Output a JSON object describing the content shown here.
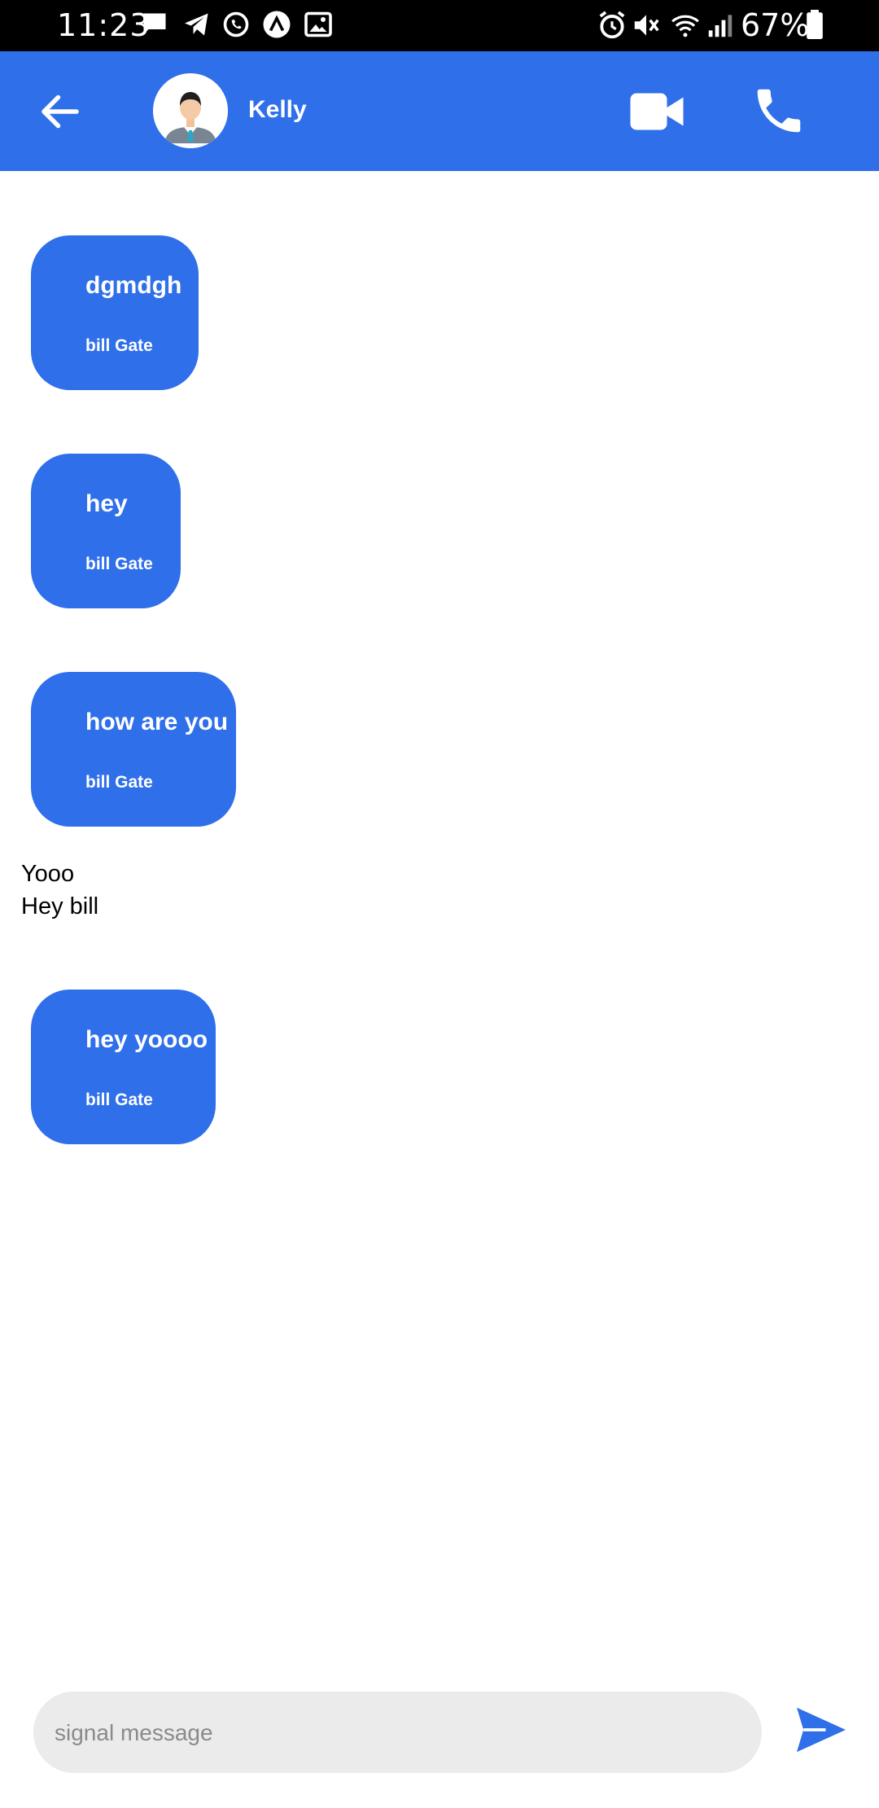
{
  "status_bar": {
    "time": "11:23",
    "battery_percent": "67%",
    "icons": [
      "message-icon",
      "telegram-icon",
      "whatsapp-icon",
      "arrow-up-circle-icon",
      "image-icon",
      "alarm-icon",
      "mute-icon",
      "wifi-icon",
      "signal-icon",
      "battery-icon"
    ]
  },
  "header": {
    "contact_name": "Kelly",
    "icons": [
      "back-arrow-icon",
      "avatar",
      "video-camera-icon",
      "phone-icon"
    ]
  },
  "messages": [
    {
      "type": "bubble",
      "text": "dgmdgh",
      "sender": "bill Gate"
    },
    {
      "type": "bubble",
      "text": "hey",
      "sender": "bill Gate"
    },
    {
      "type": "bubble",
      "text": "how are you",
      "sender": "bill Gate"
    },
    {
      "type": "plain",
      "lines": [
        "Yooo",
        "Hey bill"
      ]
    },
    {
      "type": "bubble",
      "text": "hey yoooo",
      "sender": "bill Gate"
    }
  ],
  "composer": {
    "placeholder": "signal message",
    "value": "",
    "send_icon": "send-icon"
  },
  "colors": {
    "primary": "#2f6fea",
    "status_bar": "#000000",
    "input_background": "#ebebeb"
  }
}
